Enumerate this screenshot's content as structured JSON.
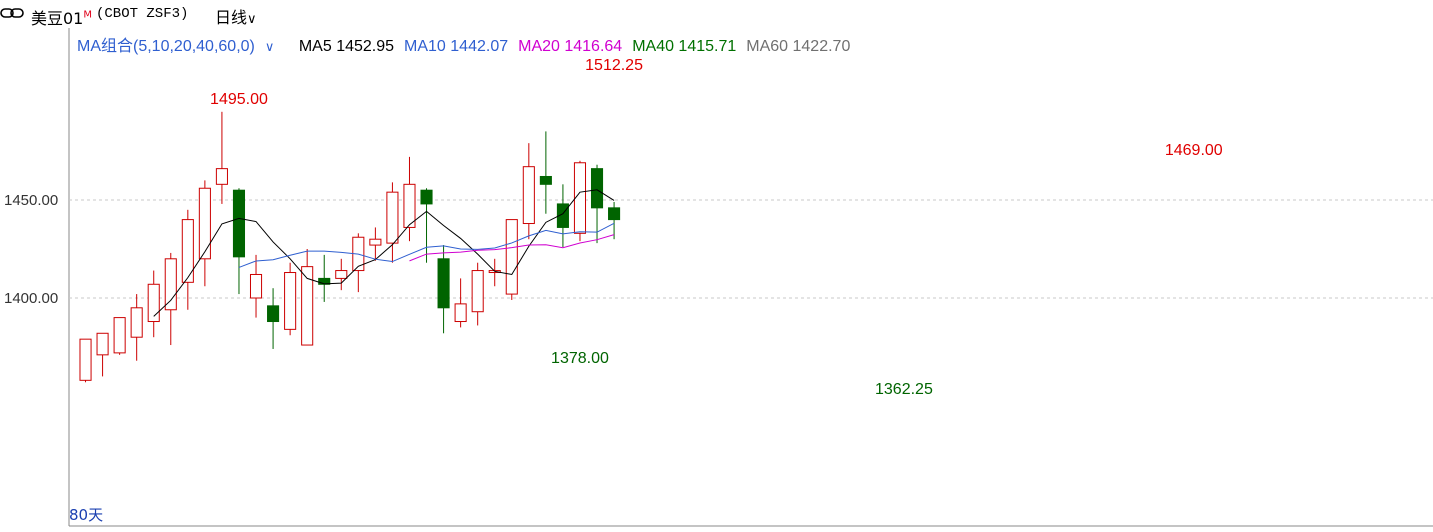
{
  "header": {
    "title": "美豆01",
    "title_mark": "M",
    "code": "(CBOT ZSF3)",
    "period": "日线",
    "period_arrow": "∨"
  },
  "ma_bar": {
    "combo_label": "MA组合(5,10,20,40,60,0)",
    "combo_arrow": "∨",
    "items": [
      {
        "label": "MA5",
        "value": "1452.95",
        "color": "#000000"
      },
      {
        "label": "MA10",
        "value": "1442.07",
        "color": "#2f5fd0"
      },
      {
        "label": "MA20",
        "value": "1416.64",
        "color": "#d000d0"
      },
      {
        "label": "MA40",
        "value": "1415.71",
        "color": "#007000"
      },
      {
        "label": "MA60",
        "value": "1422.70",
        "color": "#707070"
      }
    ]
  },
  "footer": {
    "days_label": "80天"
  },
  "colors": {
    "up": "#cc0000",
    "down": "#006400",
    "grid": "#c8c8c8",
    "axis": "#888888"
  },
  "chart_data": {
    "type": "candlestick",
    "y_ticks": [
      1400,
      1450
    ],
    "y_tick_labels": [
      "1400.00",
      "1450.00"
    ],
    "ylim": [
      1348,
      1520
    ],
    "annotations": [
      {
        "label": "1495.00",
        "index": 9,
        "value": 1495.0,
        "kind": "high"
      },
      {
        "label": "1378.00",
        "index": 29,
        "value": 1378.0,
        "kind": "low"
      },
      {
        "label": "1512.25",
        "index": 31,
        "value": 1512.25,
        "kind": "high"
      },
      {
        "label": "1362.25",
        "index": 48,
        "value": 1362.25,
        "kind": "low"
      },
      {
        "label": "1469.00",
        "index": 65,
        "value": 1469.0,
        "kind": "high"
      }
    ],
    "candles": [
      [
        1358,
        1379,
        1371,
        1357
      ],
      [
        1371,
        1382,
        1378,
        1360
      ],
      [
        1372,
        1390,
        1390,
        1371
      ],
      [
        1380,
        1395,
        1402,
        1368
      ],
      [
        1388,
        1407,
        1414,
        1380
      ],
      [
        1394,
        1420,
        1423,
        1376
      ],
      [
        1408,
        1440,
        1445,
        1394
      ],
      [
        1420,
        1456,
        1460,
        1406
      ],
      [
        1458,
        1466,
        1495,
        1448
      ],
      [
        1455,
        1421,
        1456,
        1402
      ],
      [
        1400,
        1412,
        1422,
        1390
      ],
      [
        1396,
        1388,
        1405,
        1374
      ],
      [
        1384,
        1413,
        1418,
        1381
      ],
      [
        1376,
        1416,
        1425,
        1376
      ],
      [
        1410,
        1407,
        1422,
        1398
      ],
      [
        1410,
        1414,
        1420,
        1404
      ],
      [
        1414,
        1431,
        1433,
        1403
      ],
      [
        1427,
        1430,
        1436,
        1419
      ],
      [
        1428,
        1454,
        1459,
        1418
      ],
      [
        1436,
        1458,
        1472,
        1429
      ],
      [
        1455,
        1448,
        1456,
        1418
      ],
      [
        1420,
        1395,
        1427,
        1382
      ],
      [
        1388,
        1397,
        1410,
        1385
      ],
      [
        1393,
        1414,
        1418,
        1386
      ],
      [
        1413,
        1414,
        1420,
        1406
      ],
      [
        1402,
        1440,
        1440,
        1399
      ],
      [
        1438,
        1467,
        1479,
        1430
      ],
      [
        1462,
        1458,
        1485,
        1443
      ],
      [
        1448,
        1436,
        1458,
        1426
      ],
      [
        1433,
        1469,
        1470,
        1429
      ],
      [
        1466,
        1446,
        1468,
        1428
      ],
      [
        1446,
        1440,
        1449,
        1430
      ]
    ],
    "x_axis": "80 daily bars (partial reading)"
  }
}
